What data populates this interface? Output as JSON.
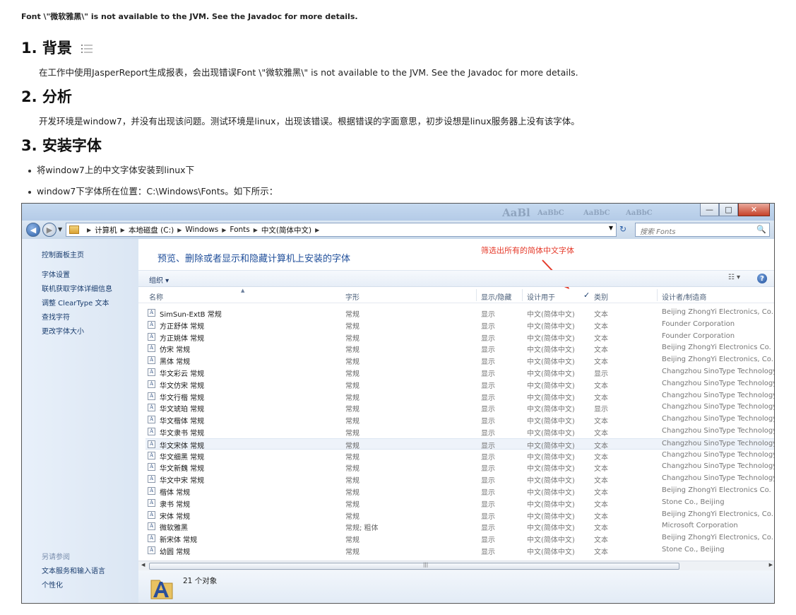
{
  "error_line": "Font \\\"微软雅黑\\\" is not available to the JVM. See the Javadoc for more details.",
  "sections": [
    {
      "heading": "1. 背景",
      "text": "在工作中使用JasperReport生成报表，会出现错误Font \\\"微软雅黑\\\" is not available to the JVM. See the Javadoc for more details."
    },
    {
      "heading": "2. 分析",
      "text": "开发环境是window7，并没有出现该问题。测试环境是linux，出现该错误。根据错误的字面意思，初步设想是linux服务器上没有该字体。"
    },
    {
      "heading": "3. 安装字体"
    }
  ],
  "bullets": [
    "将window7上的中文字体安装到linux下",
    "window7下字体所在位置：C:\\Windows\\Fonts。如下所示："
  ],
  "explorer": {
    "title_ghost": [
      "AaBl",
      "AaBbC",
      "AaBbC",
      "AaBbC"
    ],
    "breadcrumb": [
      "计算机",
      "本地磁盘 (C:)",
      "Windows",
      "Fonts",
      "中文(简体中文)"
    ],
    "search_placeholder": "搜索 Fonts",
    "left_links": [
      "控制面板主页",
      "字体设置",
      "联机获取字体详细信息",
      "调整 ClearType 文本",
      "查找字符",
      "更改字体大小"
    ],
    "see_also": "另请参阅",
    "see_also_links": [
      "文本服务和输入语言",
      "个性化"
    ],
    "header_title": "预览、删除或者显示和隐藏计算机上安装的字体",
    "annotation": "筛选出所有的简体中文字体",
    "organize": "组织 ▾",
    "columns": {
      "name": "名称",
      "style": "字形",
      "show": "显示/隐藏",
      "design": "设计用于",
      "cat": "类别",
      "maker": "设计者/制造商"
    },
    "rows": [
      [
        "SimSun-ExtB 常规",
        "常规",
        "显示",
        "中文(简体中文)",
        "文本",
        "Beijing ZhongYi Electronics, Co."
      ],
      [
        "方正舒体 常规",
        "常规",
        "显示",
        "中文(简体中文)",
        "文本",
        "Founder Corporation"
      ],
      [
        "方正姚体 常规",
        "常规",
        "显示",
        "中文(简体中文)",
        "文本",
        "Founder Corporation"
      ],
      [
        "仿宋 常规",
        "常规",
        "显示",
        "中文(简体中文)",
        "文本",
        "Beijing ZhongYi Electronics Co."
      ],
      [
        "黑体 常规",
        "常规",
        "显示",
        "中文(简体中文)",
        "文本",
        "Beijing ZhongYi Electronics, Co."
      ],
      [
        "华文彩云 常规",
        "常规",
        "显示",
        "中文(简体中文)",
        "显示",
        "Changzhou SinoType Technology"
      ],
      [
        "华文仿宋 常规",
        "常规",
        "显示",
        "中文(简体中文)",
        "文本",
        "Changzhou SinoType Technology"
      ],
      [
        "华文行楷 常规",
        "常规",
        "显示",
        "中文(简体中文)",
        "文本",
        "Changzhou SinoType Technology"
      ],
      [
        "华文琥珀 常规",
        "常规",
        "显示",
        "中文(简体中文)",
        "显示",
        "Changzhou SinoType Technology"
      ],
      [
        "华文楷体 常规",
        "常规",
        "显示",
        "中文(简体中文)",
        "文本",
        "Changzhou SinoType Technology"
      ],
      [
        "华文隶书 常规",
        "常规",
        "显示",
        "中文(简体中文)",
        "文本",
        "Changzhou SinoType Technology"
      ],
      [
        "华文宋体 常规",
        "常规",
        "显示",
        "中文(简体中文)",
        "文本",
        "Changzhou SinoType Technology"
      ],
      [
        "华文细黑 常规",
        "常规",
        "显示",
        "中文(简体中文)",
        "文本",
        "Changzhou SinoType Technology"
      ],
      [
        "华文新魏 常规",
        "常规",
        "显示",
        "中文(简体中文)",
        "文本",
        "Changzhou SinoType Technology"
      ],
      [
        "华文中宋 常规",
        "常规",
        "显示",
        "中文(简体中文)",
        "文本",
        "Changzhou SinoType Technology"
      ],
      [
        "楷体 常规",
        "常规",
        "显示",
        "中文(简体中文)",
        "文本",
        "Beijing ZhongYi Electronics Co."
      ],
      [
        "隶书 常规",
        "常规",
        "显示",
        "中文(简体中文)",
        "文本",
        "Stone Co., Beijing"
      ],
      [
        "宋体 常规",
        "常规",
        "显示",
        "中文(简体中文)",
        "文本",
        "Beijing ZhongYi Electronics, Co."
      ],
      [
        "微软雅黑",
        "常规; 粗体",
        "显示",
        "中文(简体中文)",
        "文本",
        "Microsoft Corporation"
      ],
      [
        "新宋体 常规",
        "常规",
        "显示",
        "中文(简体中文)",
        "文本",
        "Beijing ZhongYi Electronics, Co."
      ],
      [
        "幼圆 常规",
        "常规",
        "显示",
        "中文(简体中文)",
        "文本",
        "Stone Co., Beijing"
      ]
    ],
    "selected_row": 11,
    "status_text": "21 个对象"
  },
  "colors": {
    "link": "#1a3d6e",
    "header_title": "#1f4e9a",
    "annotation": "#e53b2b"
  }
}
